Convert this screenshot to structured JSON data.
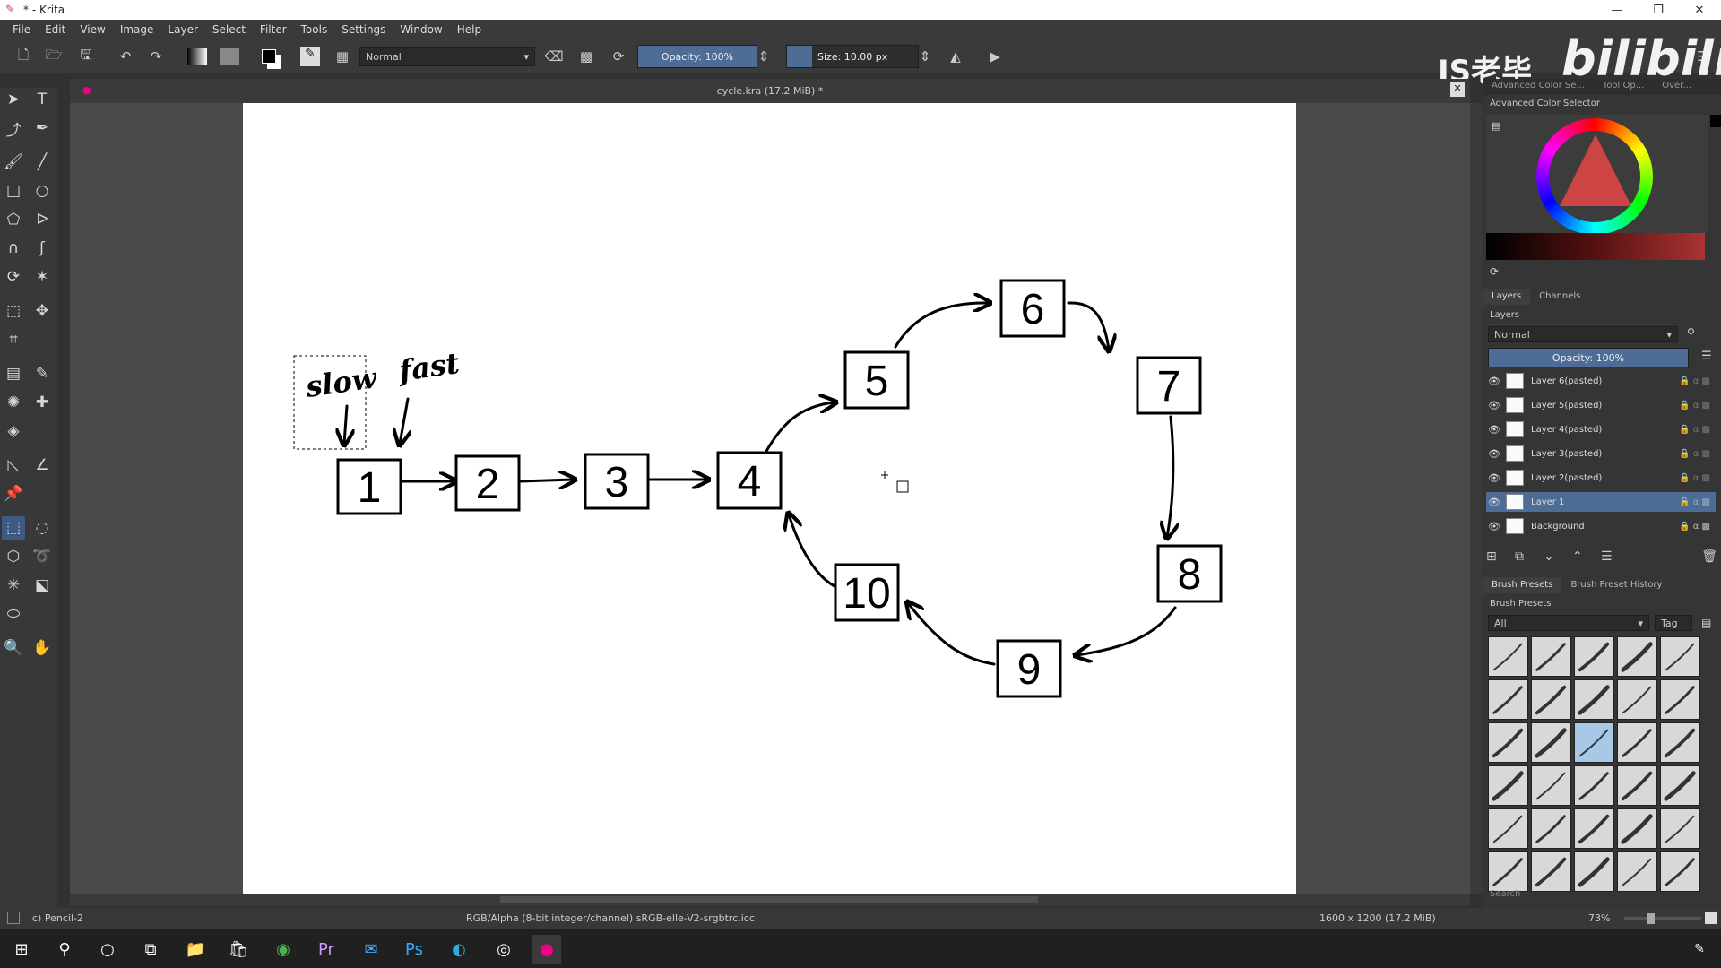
{
  "window": {
    "title": "* - Krita",
    "min": "—",
    "restore": "❐",
    "close": "✕"
  },
  "menu": [
    "File",
    "Edit",
    "View",
    "Image",
    "Layer",
    "Select",
    "Filter",
    "Tools",
    "Settings",
    "Window",
    "Help"
  ],
  "toolbar": {
    "blend_mode": "Normal",
    "opacity": "Opacity: 100%",
    "size": "Size: 10.00 px"
  },
  "document": {
    "tab_title": "cycle.kra (17.2 MiB) *"
  },
  "watermark": {
    "text": "JS老毕",
    "logo": "bilibili"
  },
  "dock": {
    "tabs_top": [
      "Advanced Color Se...",
      "Tool Op...",
      "Over..."
    ],
    "color_title": "Advanced Color Selector",
    "layer_tabs": [
      "Layers",
      "Channels"
    ],
    "layers_title": "Layers",
    "layer_blend": "Normal",
    "layer_opacity": "Opacity:  100%",
    "layers": [
      {
        "name": "Layer 6(pasted)",
        "selected": false
      },
      {
        "name": "Layer 5(pasted)",
        "selected": false
      },
      {
        "name": "Layer 4(pasted)",
        "selected": false
      },
      {
        "name": "Layer 3(pasted)",
        "selected": false
      },
      {
        "name": "Layer 2(pasted)",
        "selected": false
      },
      {
        "name": "Layer 1",
        "selected": true
      },
      {
        "name": "Background",
        "selected": false
      }
    ],
    "brush_tabs": [
      "Brush Presets",
      "Brush Preset History"
    ],
    "brush_title": "Brush Presets",
    "brush_filter": "All",
    "brush_tag": "Tag",
    "search_placeholder": "Search"
  },
  "drawing": {
    "labels": {
      "slow": "slow",
      "fast": "fast"
    },
    "nodes": [
      "1",
      "2",
      "3",
      "4",
      "5",
      "6",
      "7",
      "8",
      "9",
      "10"
    ]
  },
  "status": {
    "brush": "c) Pencil-2",
    "color": "RGB/Alpha (8-bit integer/channel)  sRGB-elle-V2-srgbtrc.icc",
    "dims": "1600 x 1200 (17.2 MiB)",
    "zoom": "73%"
  },
  "colors": {
    "accent": "#4d6c96",
    "canvas_bg": "#4a4a4a",
    "panel": "#353535"
  }
}
